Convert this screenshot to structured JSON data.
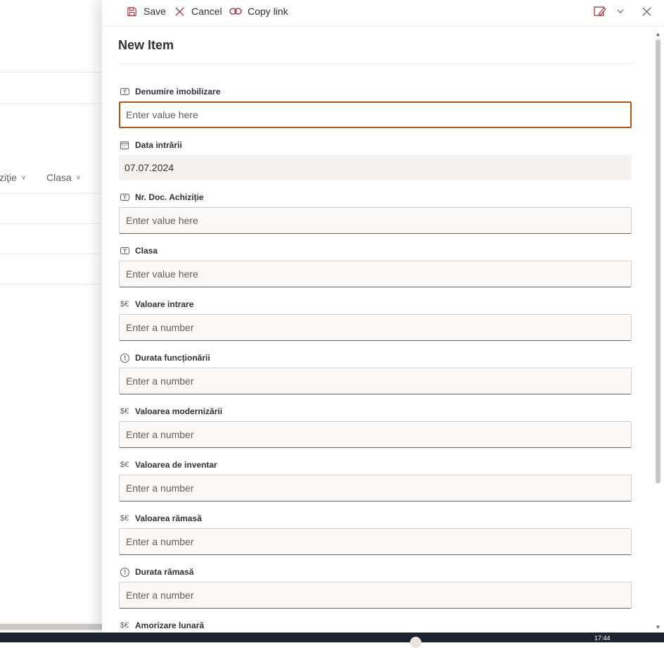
{
  "background": {
    "columns": [
      {
        "label": "ziție"
      },
      {
        "label": "Clasa"
      }
    ]
  },
  "commandbar": {
    "save_label": "Save",
    "cancel_label": "Cancel",
    "copy_link_label": "Copy link"
  },
  "form": {
    "title": "New Item",
    "fields": [
      {
        "label": "Denumire imobilizare",
        "icon": "text-field-icon",
        "placeholder": "Enter value here"
      },
      {
        "label": "Data intrării",
        "icon": "calendar-icon",
        "value": "07.07.2024"
      },
      {
        "label": "Nr. Doc. Achiziție",
        "icon": "text-field-icon",
        "placeholder": "Enter value here"
      },
      {
        "label": "Clasa",
        "icon": "text-field-icon",
        "placeholder": "Enter value here"
      },
      {
        "label": "Valoare intrare",
        "icon": "currency-icon",
        "placeholder": "Enter a number"
      },
      {
        "label": "Durata funcționării",
        "icon": "number-icon",
        "placeholder": "Enter a number"
      },
      {
        "label": "Valoarea modernizării",
        "icon": "currency-icon",
        "placeholder": "Enter a number"
      },
      {
        "label": "Valoarea de inventar",
        "icon": "currency-icon",
        "placeholder": "Enter a number"
      },
      {
        "label": "Valoarea rămasă",
        "icon": "currency-icon",
        "placeholder": "Enter a number"
      },
      {
        "label": "Durata rămasă",
        "icon": "number-icon",
        "placeholder": "Enter a number"
      },
      {
        "label": "Amorizare lunară",
        "icon": "currency-icon"
      }
    ]
  },
  "taskbar": {
    "time": "17:44"
  },
  "colors": {
    "focus_border": "#b4541a",
    "field_bg": "#faf9f8",
    "readonly_bg": "#f3f2f1"
  }
}
